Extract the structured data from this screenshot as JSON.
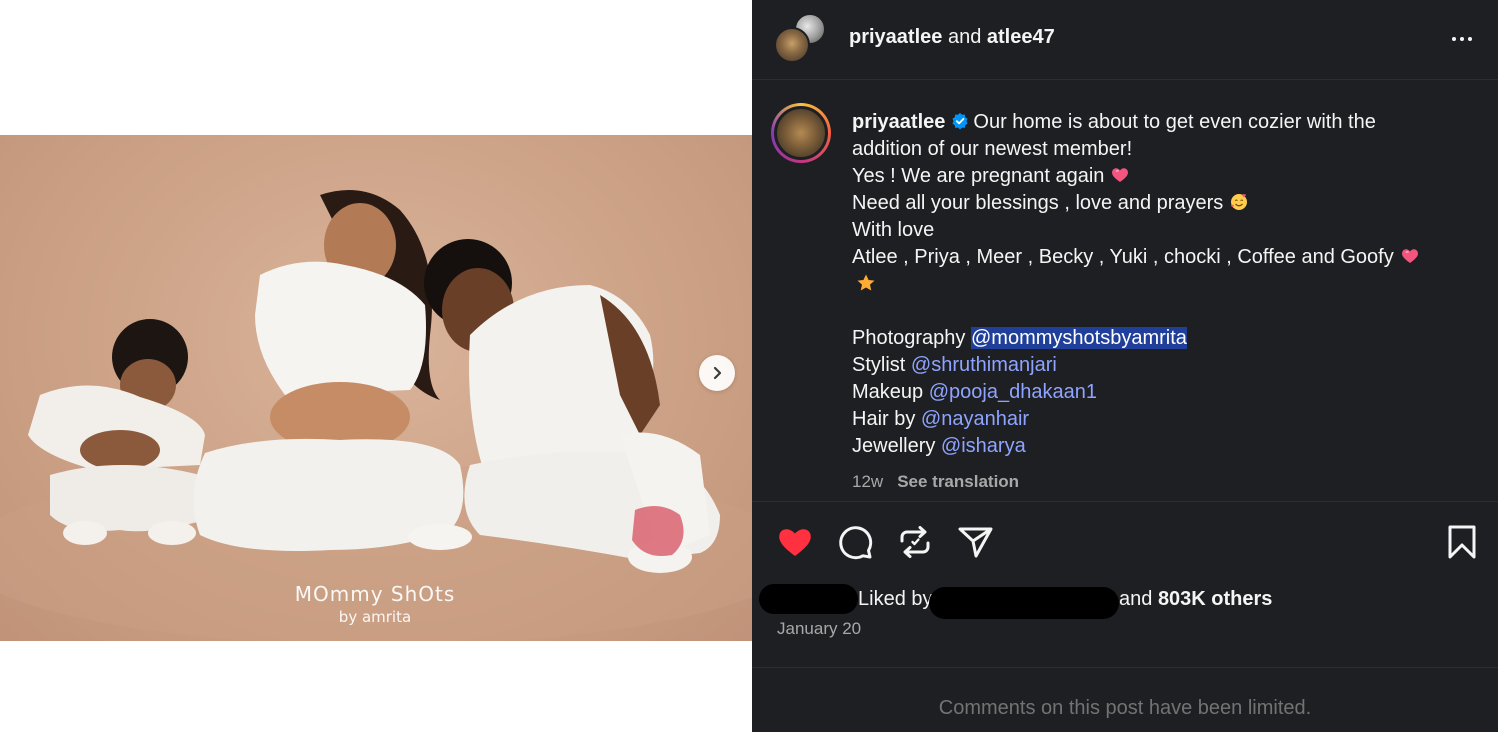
{
  "post": {
    "header": {
      "author1": "priyaatlee",
      "connector": "and",
      "author2": "atlee47"
    },
    "media": {
      "watermark_line1": "MOmmy ShOts",
      "watermark_line2": "by amrita"
    },
    "caption": {
      "username": "priyaatlee",
      "lines": [
        "Our home is about to get even cozier with the",
        "addition of our newest member!",
        "Yes ! We are pregnant again",
        "Need all your blessings , love and prayers",
        "With love",
        "Atlee , Priya , Meer , Becky , Yuki , chocki , Coffee and Goofy"
      ],
      "credits": [
        {
          "label": "Photography",
          "handle": "@mommyshotsbyamrita"
        },
        {
          "label": "Stylist",
          "handle": "@shruthimanjari"
        },
        {
          "label": "Makeup",
          "handle": "@pooja_dhakaan1"
        },
        {
          "label": "Hair by",
          "handle": "@nayanhair"
        },
        {
          "label": "Jewellery",
          "handle": "@isharya"
        }
      ],
      "age": "12w",
      "see_translation": "See translation"
    },
    "icons": {
      "like": "heart-icon",
      "comment": "comment-icon",
      "repost": "repost-icon",
      "share": "share-icon",
      "save": "bookmark-icon",
      "more": "more-options-icon",
      "next": "chevron-right-icon",
      "verified": "verified-badge-icon"
    },
    "colors": {
      "panel_bg": "#1e1f22",
      "like_red": "#ff3040",
      "mention_blue": "#8ea4ff",
      "selection_blue": "#1f3f9a",
      "verified_blue": "#0095f6"
    },
    "likes": {
      "prefix": "Liked by",
      "connector": "and",
      "count": "803K others"
    },
    "date": "January 20",
    "comments_notice": "Comments on this post have been limited."
  }
}
